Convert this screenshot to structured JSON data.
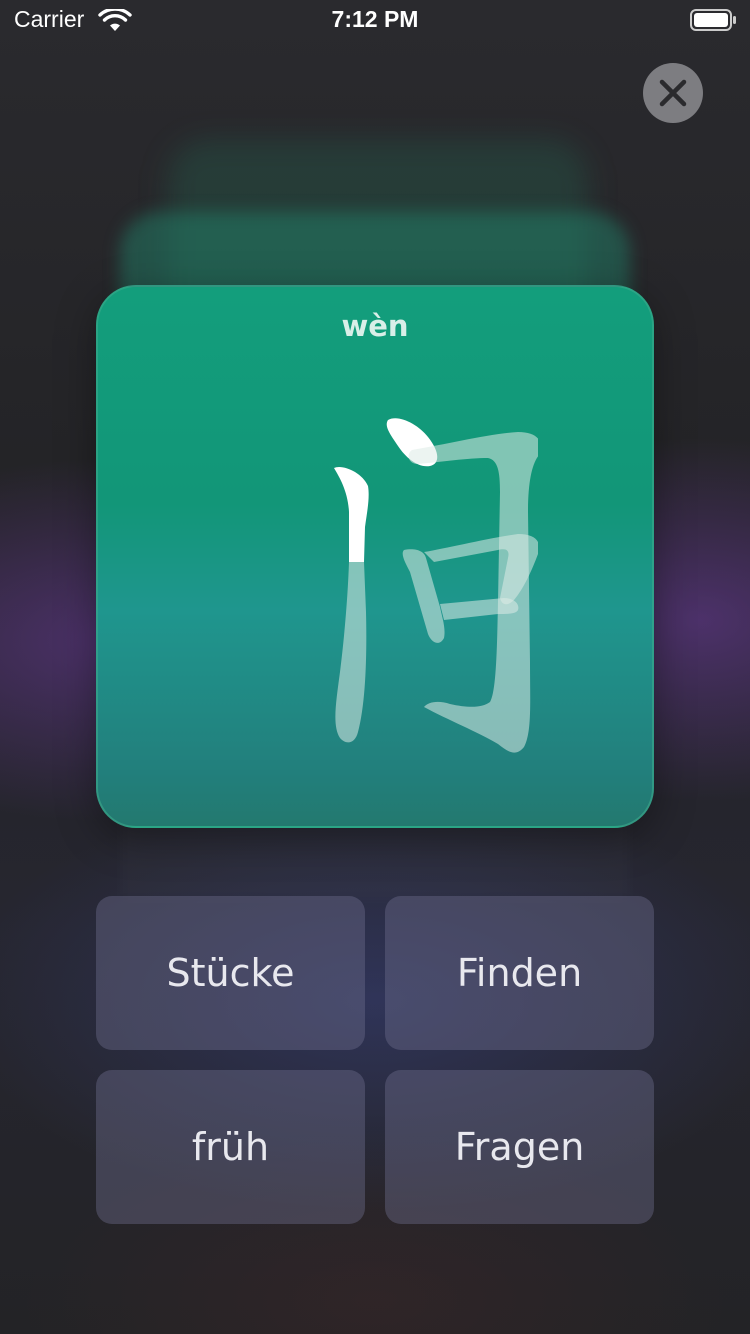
{
  "status_bar": {
    "carrier": "Carrier",
    "time": "7:12 PM",
    "wifi_icon": "wifi-icon",
    "battery_icon": "battery-icon"
  },
  "close_button": {
    "icon": "close-icon"
  },
  "card": {
    "pinyin": "wèn",
    "character": "问",
    "color": "#129678"
  },
  "options": [
    {
      "label": "Stücke"
    },
    {
      "label": "Finden"
    },
    {
      "label": "früh"
    },
    {
      "label": "Fragen"
    }
  ]
}
